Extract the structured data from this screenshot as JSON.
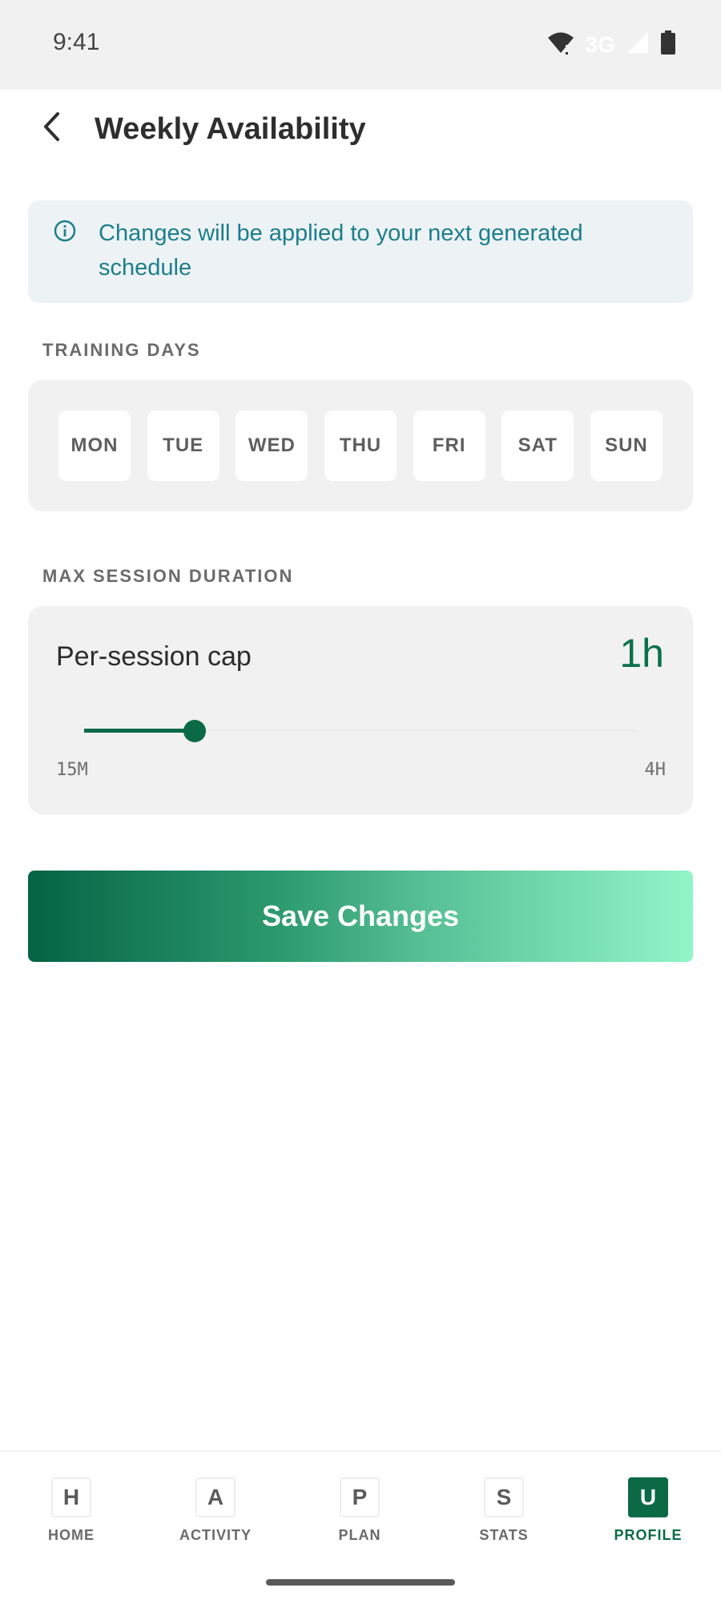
{
  "status_bar": {
    "time": "9:41",
    "network": "3G",
    "icons": [
      "wifi-icon",
      "cellular-signal-icon",
      "battery-icon"
    ]
  },
  "header": {
    "back_icon": "chevron-left-icon",
    "title": "Weekly Availability"
  },
  "info_banner": {
    "icon": "info-icon",
    "text": "Changes will be applied to your next generated schedule"
  },
  "training_days": {
    "label": "TRAINING DAYS",
    "days": [
      "MON",
      "TUE",
      "WED",
      "THU",
      "FRI",
      "SAT",
      "SUN"
    ]
  },
  "max_session": {
    "label": "MAX SESSION DURATION",
    "cap_label": "Per-session cap",
    "cap_value": "1h",
    "slider_fraction": 0.2,
    "range_min": "15M",
    "range_max": "4H"
  },
  "save_button": {
    "label": "Save Changes"
  },
  "bottom_nav": {
    "items": [
      {
        "badge": "H",
        "label": "HOME"
      },
      {
        "badge": "A",
        "label": "ACTIVITY"
      },
      {
        "badge": "P",
        "label": "PLAN"
      },
      {
        "badge": "S",
        "label": "STATS"
      },
      {
        "badge": "U",
        "label": "PROFILE"
      }
    ],
    "active": "PROFILE"
  },
  "colors": {
    "accent": "#0b6a45",
    "info_text": "#1d7e8c",
    "info_bg": "#edf3f5"
  }
}
